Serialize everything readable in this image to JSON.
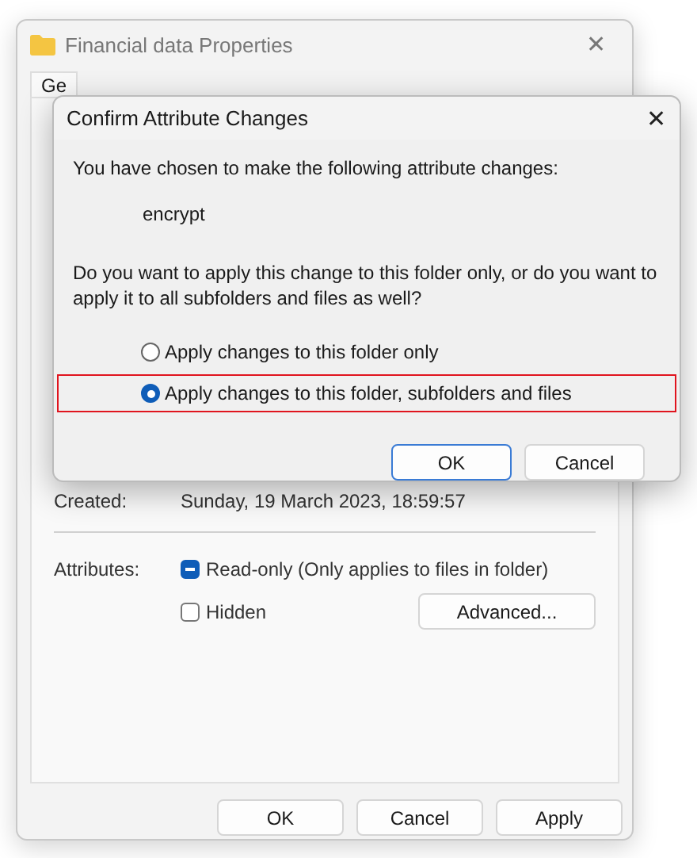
{
  "window": {
    "title": "Financial data Properties",
    "close": "✕"
  },
  "tabs": [
    {
      "label": "Ge",
      "selected": true
    }
  ],
  "general": {
    "created_label": "Created:",
    "created_value": "Sunday, 19 March 2023, 18:59:57",
    "attributes_label": "Attributes:",
    "attributes": [
      {
        "label": "Read-only (Only applies to files in folder)",
        "checked": false,
        "indeterminate": true
      },
      {
        "label": "Hidden",
        "checked": false,
        "indeterminate": false
      }
    ],
    "advanced_button": "Advanced..."
  },
  "buttons": [
    {
      "label": "OK"
    },
    {
      "label": "Cancel"
    },
    {
      "label": "Apply"
    }
  ],
  "dialog": {
    "title": "Confirm Attribute Changes",
    "close": "✕",
    "intro": "You have chosen to make the following attribute changes:",
    "change": "encrypt",
    "question": "Do you want to apply this change to this folder only, or do you want to apply it to all subfolders and files as well?",
    "options": [
      {
        "label": "Apply changes to this folder only",
        "selected": false,
        "highlighted": false
      },
      {
        "label": "Apply changes to this folder, subfolders and files",
        "selected": true,
        "highlighted": true
      }
    ],
    "buttons": [
      {
        "label": "OK",
        "default": true
      },
      {
        "label": "Cancel",
        "default": false
      }
    ]
  }
}
